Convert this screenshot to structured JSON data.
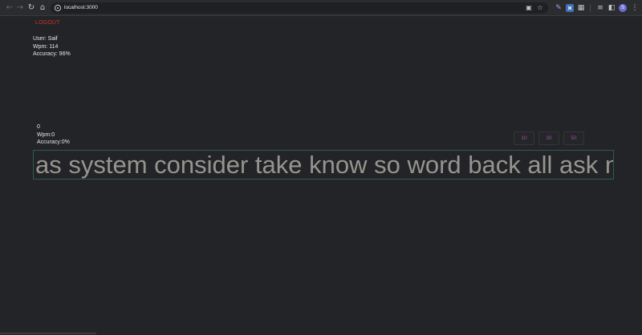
{
  "browser": {
    "url": "localhost:3000",
    "nav": {
      "back_icon": "arrow-left-icon",
      "forward_icon": "arrow-right-icon",
      "reload_icon": "reload-icon",
      "home_icon": "home-icon"
    },
    "omnibox_icons": [
      "install-app-icon",
      "star-icon"
    ],
    "extension_icons": [
      "pen-extension-icon",
      "x-extension-icon",
      "puzzle-icon",
      "media-icon",
      "sidebar-icon"
    ],
    "profile_initial": "S"
  },
  "header": {
    "logout_label": "LOGOUT"
  },
  "user_info": {
    "user": "User: Saif",
    "wpm": "Wpm: 114",
    "accuracy": "Accuracy: 96%"
  },
  "live_stats": {
    "timer": "0",
    "wpm": "Wpm:0",
    "accuracy": "Accuracy:0%"
  },
  "durations": [
    "10",
    "30",
    "50"
  ],
  "typing": {
    "words": "as system consider take know so word back all ask need"
  },
  "colors": {
    "background": "#232427",
    "logout": "#c8322e",
    "duration_text": "#9c4f9d",
    "box_border": "#2f5a54",
    "words_text": "#97948f"
  }
}
